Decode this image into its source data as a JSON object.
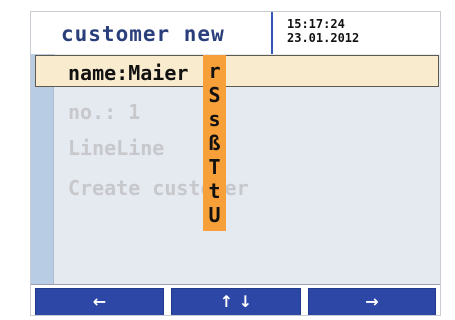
{
  "header": {
    "title": "customer new",
    "time": "15:17:24",
    "date": "23.01.2012"
  },
  "form": {
    "fields": [
      {
        "label": "name:Maier"
      },
      {
        "label": "no.: 1"
      },
      {
        "label": "LineLine"
      },
      {
        "label": "Create customer"
      }
    ]
  },
  "char_picker": {
    "chars": [
      "r",
      "S",
      "s",
      "ß",
      "T",
      "t",
      "U"
    ]
  },
  "nav": {
    "left_label": "←",
    "updown_label": "↑ ↓",
    "right_label": "→"
  },
  "colors": {
    "title": "#2a3e7b",
    "selection": "#f9ebcd",
    "picker": "#f79f38",
    "nav": "#2c47a6"
  }
}
